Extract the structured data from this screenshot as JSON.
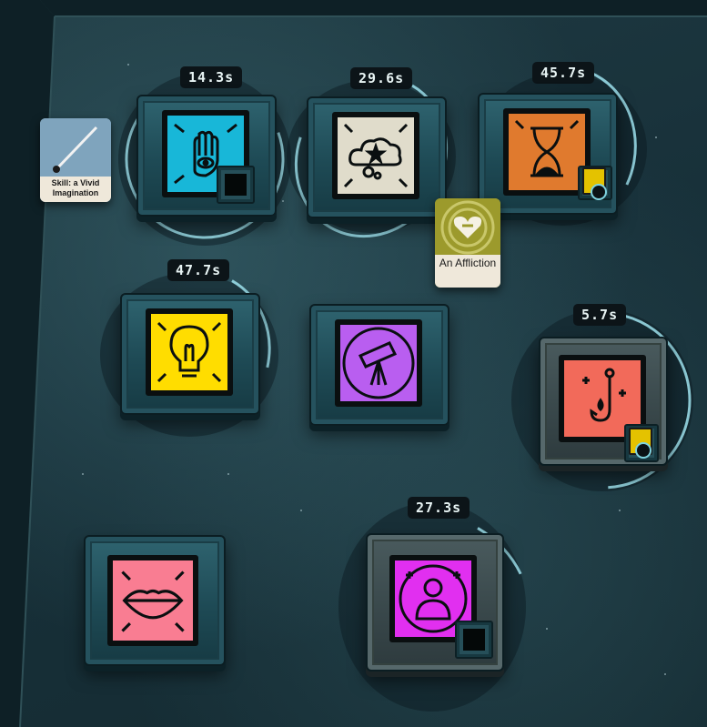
{
  "colors": {
    "background": "#18313a",
    "timer_text": "#e8f4f4",
    "progress_ring": "#9fe3ee",
    "health": "#18b7d8",
    "passion": "#e0dccb",
    "patience": "#e07a2e",
    "reason": "#ffdd00",
    "talk": "#b95ef0",
    "work": "#f26a5a",
    "dream": "#f97d92",
    "study": "#e12ff0"
  },
  "verbs": [
    {
      "id": "work-hand",
      "icon": "hand-eye-icon",
      "timer": "14.3s",
      "progress": 0.65
    },
    {
      "id": "dream-cloud",
      "icon": "cloud-star-icon",
      "timer": "29.6s",
      "progress": 0.7
    },
    {
      "id": "time-hourglass",
      "icon": "hourglass-icon",
      "timer": "45.7s",
      "progress": 0.3
    },
    {
      "id": "study-bulb",
      "icon": "lightbulb-icon",
      "timer": "47.7s",
      "progress": 0.2
    },
    {
      "id": "explore-telescope",
      "icon": "telescope-icon"
    },
    {
      "id": "hunt-hook",
      "icon": "hook-icon",
      "timer": "5.7s",
      "progress": 0.45
    },
    {
      "id": "talk-lips",
      "icon": "lips-icon"
    },
    {
      "id": "recruit-person",
      "icon": "person-icon",
      "timer": "27.3s",
      "progress": 0.1
    }
  ],
  "cards": {
    "skill": {
      "label": "Skill: a Vivid Imagination",
      "icon": "paintbrush-icon"
    },
    "affliction": {
      "label": "An Affliction",
      "icon": "heart-minus-icon"
    }
  }
}
